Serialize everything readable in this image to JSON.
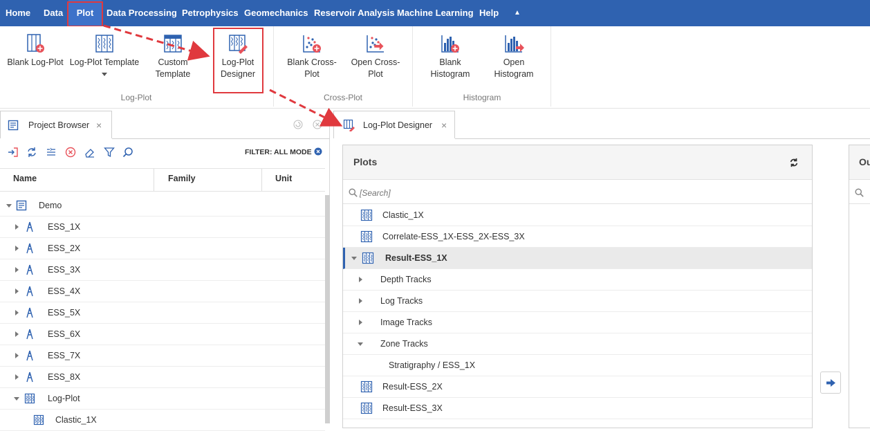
{
  "menu": {
    "items": [
      "Home",
      "Data",
      "Plot",
      "Data Processing",
      "Petrophysics",
      "Geomechanics",
      "Reservoir Analysis",
      "Machine Learning",
      "Help"
    ],
    "active": "Plot",
    "collapse_glyph": "▲"
  },
  "ribbon": {
    "groups": {
      "log_plot": "Log-Plot",
      "cross_plot": "Cross-Plot",
      "histogram": "Histogram"
    },
    "buttons": {
      "blank_log_plot": "Blank Log-Plot",
      "log_plot_template": "Log-Plot Template",
      "custom_template": [
        "Custom",
        "Template"
      ],
      "log_plot_designer": [
        "Log-Plot",
        "Designer"
      ],
      "blank_cross_plot": [
        "Blank Cross-",
        "Plot"
      ],
      "open_cross_plot": [
        "Open Cross-",
        "Plot"
      ],
      "blank_histogram": [
        "Blank",
        "Histogram"
      ],
      "open_histogram": [
        "Open",
        "Histogram"
      ]
    }
  },
  "project_browser": {
    "tab_label": "Project Browser",
    "close_glyph": "×",
    "filter_label": "FILTER: ALL MODE",
    "columns": [
      "Name",
      "Family",
      "Unit"
    ],
    "tree": [
      {
        "label": "Demo",
        "level": 0,
        "expanded": true,
        "icon": "project-icon"
      },
      {
        "label": "ESS_1X",
        "level": 1,
        "expanded": false,
        "icon": "well-icon"
      },
      {
        "label": "ESS_2X",
        "level": 1,
        "expanded": false,
        "icon": "well-icon"
      },
      {
        "label": "ESS_3X",
        "level": 1,
        "expanded": false,
        "icon": "well-icon"
      },
      {
        "label": "ESS_4X",
        "level": 1,
        "expanded": false,
        "icon": "well-icon"
      },
      {
        "label": "ESS_5X",
        "level": 1,
        "expanded": false,
        "icon": "well-icon"
      },
      {
        "label": "ESS_6X",
        "level": 1,
        "expanded": false,
        "icon": "well-icon"
      },
      {
        "label": "ESS_7X",
        "level": 1,
        "expanded": false,
        "icon": "well-icon"
      },
      {
        "label": "ESS_8X",
        "level": 1,
        "expanded": false,
        "icon": "well-icon"
      },
      {
        "label": "Log-Plot",
        "level": 1,
        "expanded": true,
        "icon": "logplot-icon"
      },
      {
        "label": "Clastic_1X",
        "level": 2,
        "expanded": null,
        "icon": "logplot-icon"
      }
    ]
  },
  "designer": {
    "tab_label": "Log-Plot Designer",
    "close_glyph": "×",
    "plots_title": "Plots",
    "search_placeholder": "[Search]",
    "output_title_partial": "Ou",
    "plots": [
      {
        "label": "Clastic_1X",
        "kind": "plot"
      },
      {
        "label": "Correlate-ESS_1X-ESS_2X-ESS_3X",
        "kind": "plot"
      },
      {
        "label": "Result-ESS_1X",
        "kind": "plot-selected"
      },
      {
        "label": "Depth Tracks",
        "kind": "track-collapsed"
      },
      {
        "label": "Log Tracks",
        "kind": "track-collapsed"
      },
      {
        "label": "Image Tracks",
        "kind": "track-collapsed"
      },
      {
        "label": "Zone Tracks",
        "kind": "track-expanded"
      },
      {
        "label": "Stratigraphy / ESS_1X",
        "kind": "leaf"
      },
      {
        "label": "Result-ESS_2X",
        "kind": "plot"
      },
      {
        "label": "Result-ESS_3X",
        "kind": "plot"
      }
    ]
  },
  "colors": {
    "menu_bg": "#2f62b0",
    "highlight": "#e0393e",
    "icon_blue": "#2f62b0"
  }
}
